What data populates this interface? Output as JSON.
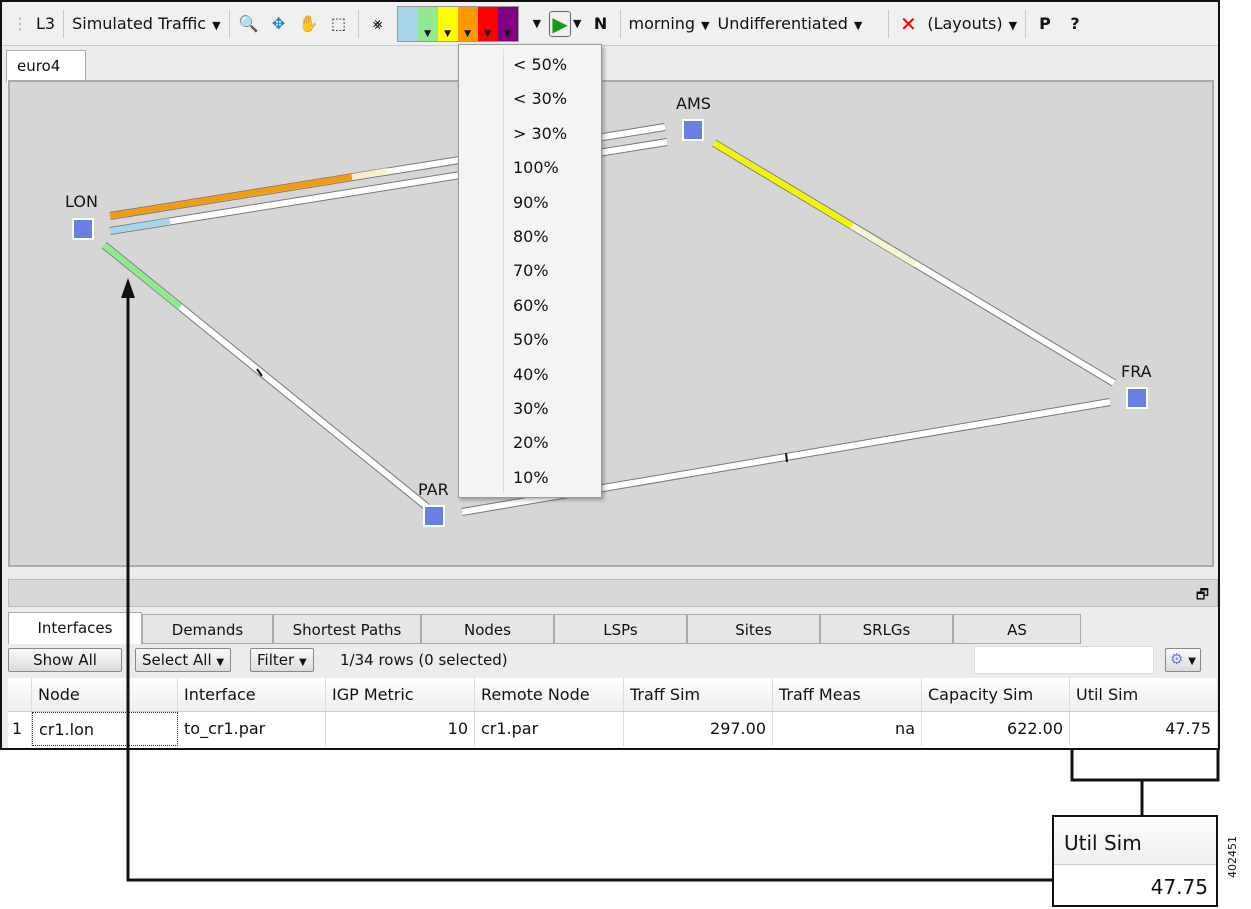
{
  "toolbar": {
    "layer": "L3",
    "traffic": "Simulated Traffic",
    "colors": [
      "#a9d3ea",
      "#90e890",
      "#ffff00",
      "#ff9900",
      "#ff0000",
      "#800080"
    ],
    "time": "morning",
    "service_class": "Undifferentiated",
    "layouts": "(Layouts)"
  },
  "doc_tab": "euro4",
  "menu": [
    "< 50%",
    "< 30%",
    "> 30%",
    "100%",
    "90%",
    "80%",
    "70%",
    "60%",
    "50%",
    "40%",
    "30%",
    "20%",
    "10%"
  ],
  "nodes": {
    "lon": "LON",
    "ams": "AMS",
    "fra": "FRA",
    "par": "PAR"
  },
  "tabs": [
    "Interfaces",
    "Demands",
    "Shortest Paths",
    "Nodes",
    "LSPs",
    "Sites",
    "SRLGs",
    "AS"
  ],
  "controls": {
    "show_all": "Show All",
    "select_all": "Select All",
    "filter": "Filter",
    "rows": "1/34 rows (0 selected)",
    "search": ""
  },
  "table": {
    "headers": [
      "Node",
      "Interface",
      "IGP Metric",
      "Remote Node",
      "Traff Sim",
      "Traff Meas",
      "Capacity Sim",
      "Util Sim"
    ],
    "rows": [
      {
        "num": "1",
        "node": "cr1.lon",
        "interface": "to_cr1.par",
        "igp": "10",
        "remote": "cr1.par",
        "traff_sim": "297.00",
        "traff_meas": "na",
        "cap": "622.00",
        "util": "47.75"
      }
    ]
  },
  "callout": {
    "header": "Util Sim",
    "value": "47.75"
  },
  "figure_id": "402451"
}
